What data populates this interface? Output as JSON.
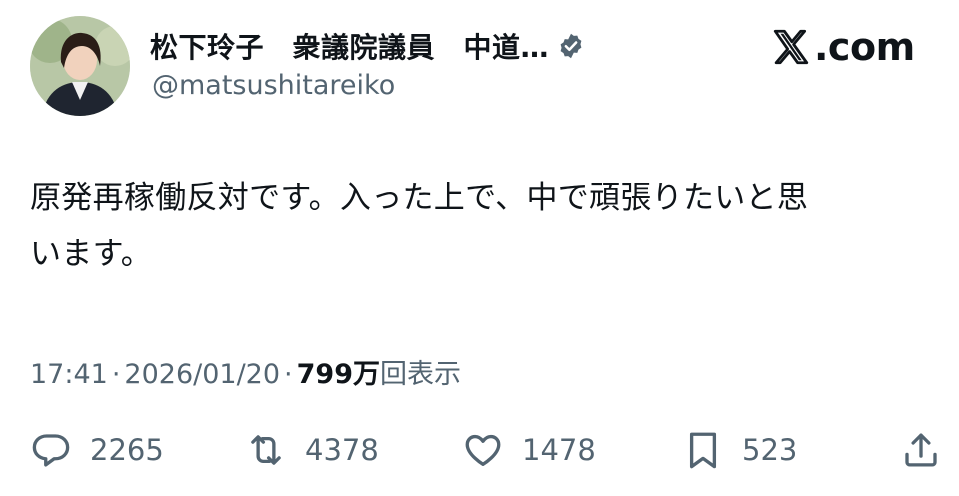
{
  "author": {
    "display_name": "松下玲子　衆議院議員　中道…",
    "handle": "@matsushitareiko",
    "verified_icon": "verified-badge-icon",
    "avatar": "profile-photo"
  },
  "brand": {
    "icon": "x-logo-icon",
    "text": ".com"
  },
  "tweet": {
    "text_lines": [
      "原発再稼働反対です。入った上で、中で頑張りたいと思",
      "います。"
    ]
  },
  "meta": {
    "time": "17:41",
    "separator": "·",
    "date": "2026/01/20",
    "views_count": "799万",
    "views_label": "回表示"
  },
  "actions": {
    "reply": {
      "icon": "reply-icon",
      "count": "2265"
    },
    "repost": {
      "icon": "repost-icon",
      "count": "4378"
    },
    "like": {
      "icon": "heart-icon",
      "count": "1478"
    },
    "bookmark": {
      "icon": "bookmark-icon",
      "count": "523"
    },
    "share": {
      "icon": "share-icon"
    }
  },
  "colors": {
    "text_primary": "#0f1419",
    "text_secondary": "#536471",
    "verified_badge": "#536471",
    "background": "#ffffff"
  }
}
